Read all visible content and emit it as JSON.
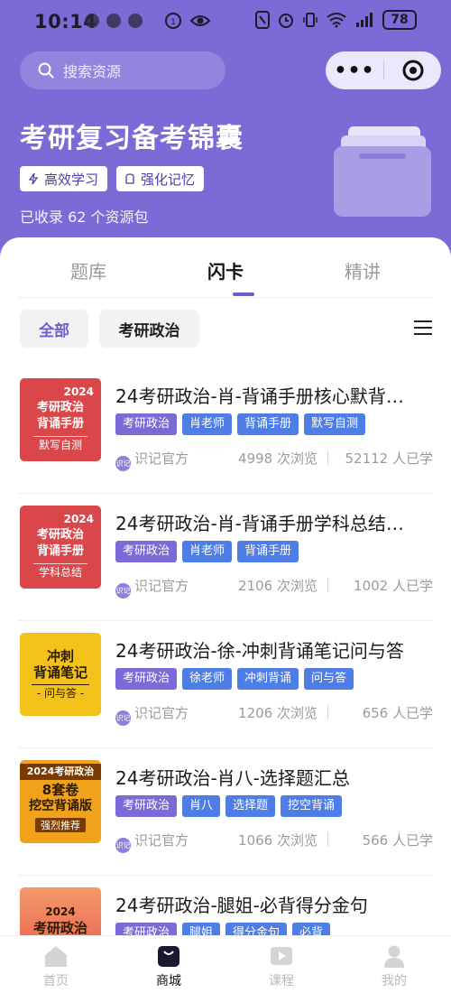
{
  "status_bar": {
    "time": "10:14",
    "battery": "78"
  },
  "search": {
    "placeholder": "搜索资源"
  },
  "capsule": {
    "more": "•••"
  },
  "hero": {
    "title": "考研复习备考锦囊",
    "chips": [
      "高效学习",
      "强化记忆"
    ],
    "count_text": "已收录 62 个资源包"
  },
  "tabs": [
    {
      "label": "题库",
      "active": false
    },
    {
      "label": "闪卡",
      "active": true
    },
    {
      "label": "精讲",
      "active": false
    }
  ],
  "filters": {
    "all": "全部",
    "category": "考研政治"
  },
  "items": [
    {
      "title": "24考研政治-肖-背诵手册核心默背…",
      "thumb": {
        "year": "2024",
        "lines": [
          "考研政治",
          "背诵手册"
        ],
        "bar": "默写自测",
        "color": "#d9474b"
      },
      "tags": [
        {
          "label": "考研政治",
          "color": "purple"
        },
        {
          "label": "肖老师",
          "color": "blue"
        },
        {
          "label": "背诵手册",
          "color": "blue"
        },
        {
          "label": "默写自测",
          "color": "blue"
        }
      ],
      "source": "识记官方",
      "views": "4998 次浏览",
      "learners": "52112 人已学"
    },
    {
      "title": "24考研政治-肖-背诵手册学科总结…",
      "thumb": {
        "year": "2024",
        "lines": [
          "考研政治",
          "背诵手册"
        ],
        "bar": "学科总结",
        "color": "#d9474b"
      },
      "tags": [
        {
          "label": "考研政治",
          "color": "purple"
        },
        {
          "label": "肖老师",
          "color": "blue"
        },
        {
          "label": "背诵手册",
          "color": "blue"
        }
      ],
      "source": "识记官方",
      "views": "2106 次浏览",
      "learners": "1002 人已学"
    },
    {
      "title": "24考研政治-徐-冲刺背诵笔记问与答",
      "thumb": {
        "year": "",
        "lines": [
          "冲刺",
          "背诵笔记"
        ],
        "bar": "- 问与答 -",
        "color": "#f2c21b"
      },
      "tags": [
        {
          "label": "考研政治",
          "color": "purple"
        },
        {
          "label": "徐老师",
          "color": "blue"
        },
        {
          "label": "冲刺背诵",
          "color": "blue"
        },
        {
          "label": "问与答",
          "color": "blue"
        }
      ],
      "source": "识记官方",
      "views": "1206 次浏览",
      "learners": "656 人已学"
    },
    {
      "title": "24考研政治-肖八-选择题汇总",
      "thumb": {
        "year": "2024考研政治",
        "lines": [
          "8套卷",
          "挖空背诵版"
        ],
        "bar": "强烈推荐",
        "color": "#f0a21a"
      },
      "tags": [
        {
          "label": "考研政治",
          "color": "purple"
        },
        {
          "label": "肖八",
          "color": "blue"
        },
        {
          "label": "选择题",
          "color": "blue"
        },
        {
          "label": "挖空背诵",
          "color": "blue"
        }
      ],
      "source": "识记官方",
      "views": "1066 次浏览",
      "learners": "566 人已学"
    },
    {
      "title": "24考研政治-腿姐-必背得分金句",
      "thumb": {
        "year": "2024",
        "lines": [
          "考研政治"
        ],
        "bar": "",
        "color": "#f07a4a"
      },
      "tags": [
        {
          "label": "考研政治",
          "color": "purple"
        },
        {
          "label": "腿姐",
          "color": "blue"
        },
        {
          "label": "得分金句",
          "color": "blue"
        },
        {
          "label": "必背",
          "color": "blue"
        }
      ],
      "source": "",
      "views": "",
      "learners": ""
    }
  ],
  "bottom_nav": [
    {
      "label": "首页",
      "icon": "home-icon",
      "active": false
    },
    {
      "label": "商城",
      "icon": "shop-bag-icon",
      "active": true
    },
    {
      "label": "课程",
      "icon": "course-icon",
      "active": false
    },
    {
      "label": "我的",
      "icon": "profile-icon",
      "active": false
    }
  ],
  "colors": {
    "header_bg": "#7b6bd6",
    "accent": "#6d5ec9",
    "tag_purple": "#7b6bd6",
    "tag_blue": "#4f7de6"
  }
}
